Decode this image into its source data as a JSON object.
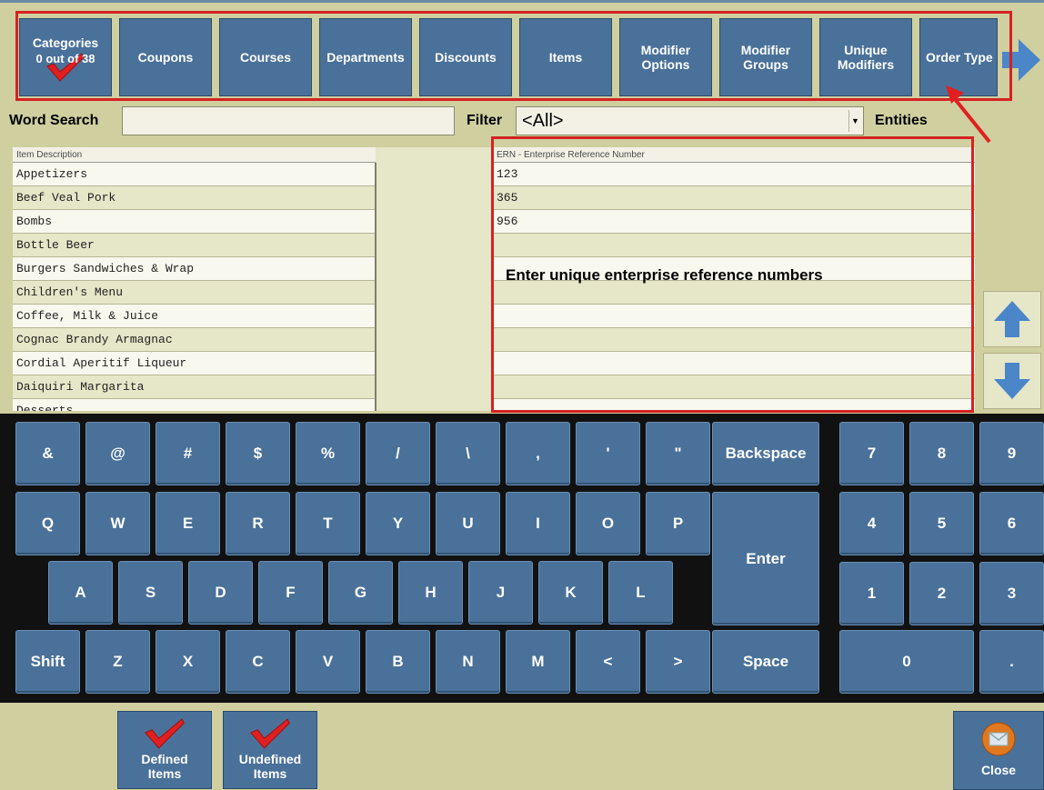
{
  "tabs": {
    "categories": {
      "label": "Categories",
      "count": "0 out of 38"
    },
    "items": [
      "Coupons",
      "Courses",
      "Departments",
      "Discounts",
      "Items",
      "Modifier Options",
      "Modifier Groups",
      "Unique Modifiers",
      "Order Type"
    ]
  },
  "search": {
    "label": "Word Search",
    "value": "",
    "placeholder": ""
  },
  "filter": {
    "label": "Filter",
    "value": "<All>"
  },
  "entities": {
    "label": "Entities"
  },
  "grid": {
    "headers": {
      "description": "Item Description",
      "ern": "ERN - Enterprise Reference Number"
    },
    "rows": [
      {
        "description": "Appetizers",
        "ern": "123"
      },
      {
        "description": "Beef Veal Pork",
        "ern": "365"
      },
      {
        "description": "Bombs",
        "ern": "956"
      },
      {
        "description": "Bottle Beer",
        "ern": ""
      },
      {
        "description": "Burgers Sandwiches & Wrap",
        "ern": ""
      },
      {
        "description": "Children's Menu",
        "ern": ""
      },
      {
        "description": "Coffee, Milk & Juice",
        "ern": ""
      },
      {
        "description": "Cognac Brandy Armagnac",
        "ern": ""
      },
      {
        "description": "Cordial Aperitif Liqueur",
        "ern": ""
      },
      {
        "description": "Daiquiri Margarita",
        "ern": ""
      },
      {
        "description": "Desserts",
        "ern": ""
      }
    ]
  },
  "annotation": "Enter unique enterprise reference numbers",
  "keyboard": {
    "row1": [
      "&",
      "@",
      "#",
      "$",
      "%",
      "/",
      "\\",
      ",",
      "'",
      "\"",
      "Backspace"
    ],
    "row2": [
      "Q",
      "W",
      "E",
      "R",
      "T",
      "Y",
      "U",
      "I",
      "O",
      "P"
    ],
    "row3": [
      "A",
      "S",
      "D",
      "F",
      "G",
      "H",
      "J",
      "K",
      "L"
    ],
    "row4": [
      "Shift",
      "Z",
      "X",
      "C",
      "V",
      "B",
      "N",
      "M",
      "<",
      ">",
      "Space"
    ],
    "enter": "Enter",
    "numpad": [
      "7",
      "8",
      "9",
      "4",
      "5",
      "6",
      "1",
      "2",
      "3",
      "0",
      "."
    ]
  },
  "bottom": {
    "defined": "Defined Items",
    "undefined": "Undefined Items",
    "close": "Close"
  },
  "colors": {
    "button": "#4a7199",
    "annotation_red": "#d42222",
    "background": "#cfcfa0",
    "check_red": "#e02020"
  }
}
